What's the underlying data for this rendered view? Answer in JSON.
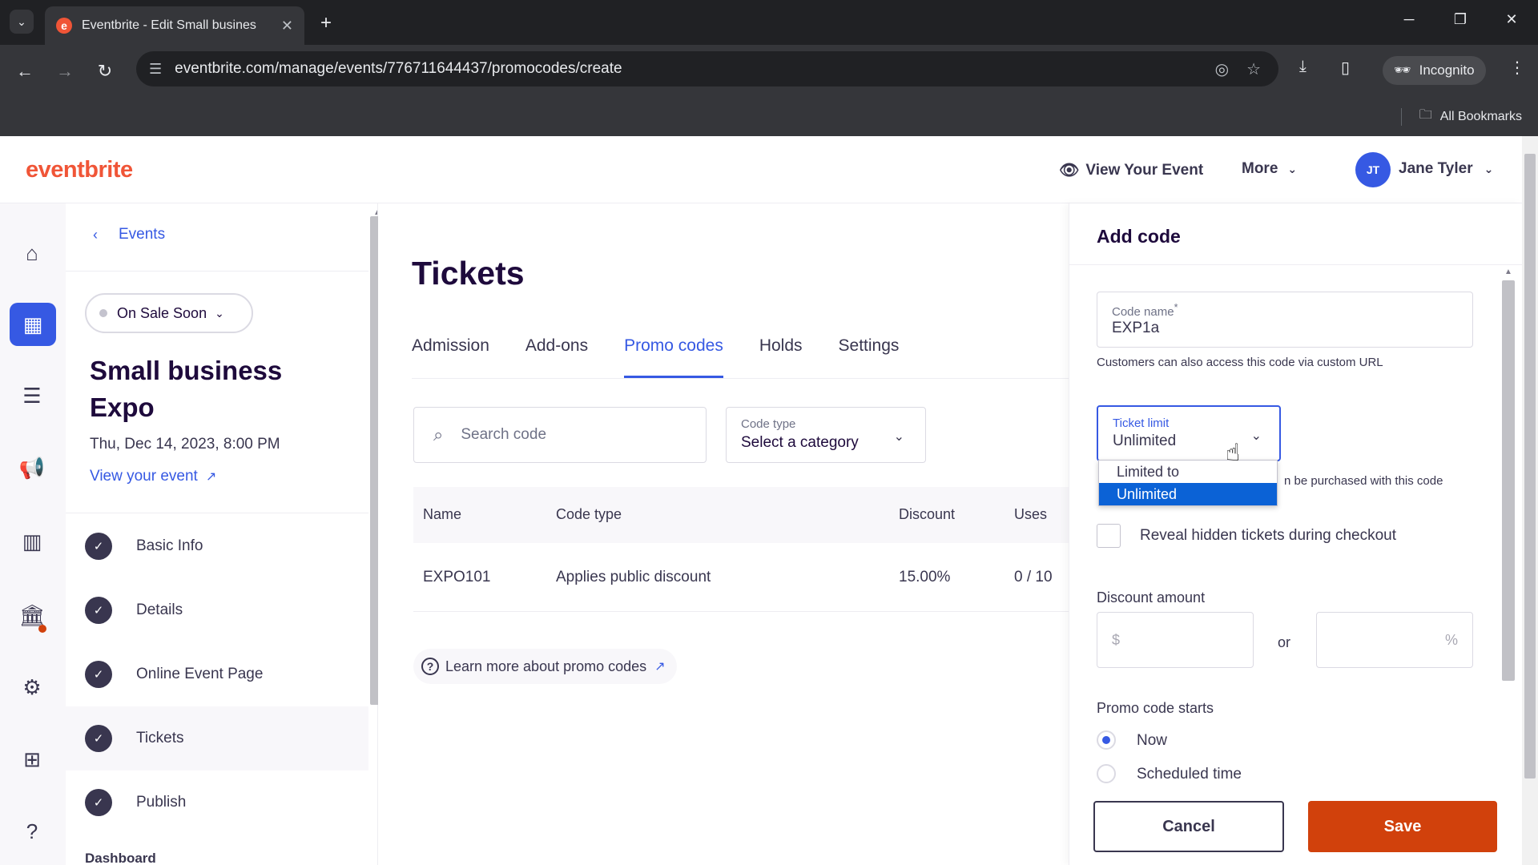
{
  "browser": {
    "tab_title": "Eventbrite - Edit Small busines",
    "url": "eventbrite.com/manage/events/776711644437/promocodes/create",
    "incognito_label": "Incognito",
    "bookmarks_label": "All Bookmarks"
  },
  "header": {
    "logo": "eventbrite",
    "view_event": "View Your Event",
    "more": "More",
    "avatar_initials": "JT",
    "user_name": "Jane Tyler"
  },
  "eventnav": {
    "back_label": "Events",
    "status": "On Sale Soon",
    "event_title": "Small business Expo",
    "event_date": "Thu, Dec 14, 2023, 8:00 PM",
    "view_link": "View your event",
    "steps": [
      {
        "label": "Basic Info"
      },
      {
        "label": "Details"
      },
      {
        "label": "Online Event Page"
      },
      {
        "label": "Tickets"
      },
      {
        "label": "Publish"
      }
    ],
    "partial_label": "Dashboard"
  },
  "main": {
    "title": "Tickets",
    "tabs": [
      "Admission",
      "Add-ons",
      "Promo codes",
      "Holds",
      "Settings"
    ],
    "active_tab": "Promo codes",
    "search_placeholder": "Search code",
    "code_type_label": "Code type",
    "code_type_value": "Select a category",
    "table": {
      "headers": [
        "Name",
        "Code type",
        "Discount",
        "Uses"
      ],
      "rows": [
        {
          "name": "EXPO101",
          "code_type": "Applies public discount",
          "discount": "15.00%",
          "uses": "0 / 10"
        }
      ]
    },
    "learn_more": "Learn more about promo codes"
  },
  "drawer": {
    "title": "Add code",
    "code_name_label": "Code name",
    "code_name_required": "*",
    "code_name_value": "EXP1a",
    "code_name_helper": "Customers can also access this code via custom URL",
    "ticket_limit_label": "Ticket limit",
    "ticket_limit_value": "Unlimited",
    "ticket_limit_options": [
      "Limited to",
      "Unlimited"
    ],
    "ticket_limit_helper_partial": "n be purchased with this code",
    "reveal_hidden": "Reveal hidden tickets during checkout",
    "discount_label": "Discount amount",
    "dollar_prefix": "$",
    "or_label": "or",
    "percent_suffix": "%",
    "starts_label": "Promo code starts",
    "start_options": [
      "Now",
      "Scheduled time"
    ],
    "cancel": "Cancel",
    "save": "Save"
  },
  "colors": {
    "brand": "#f05537",
    "primary_blue": "#3659e3",
    "save_button": "#d1410c"
  }
}
